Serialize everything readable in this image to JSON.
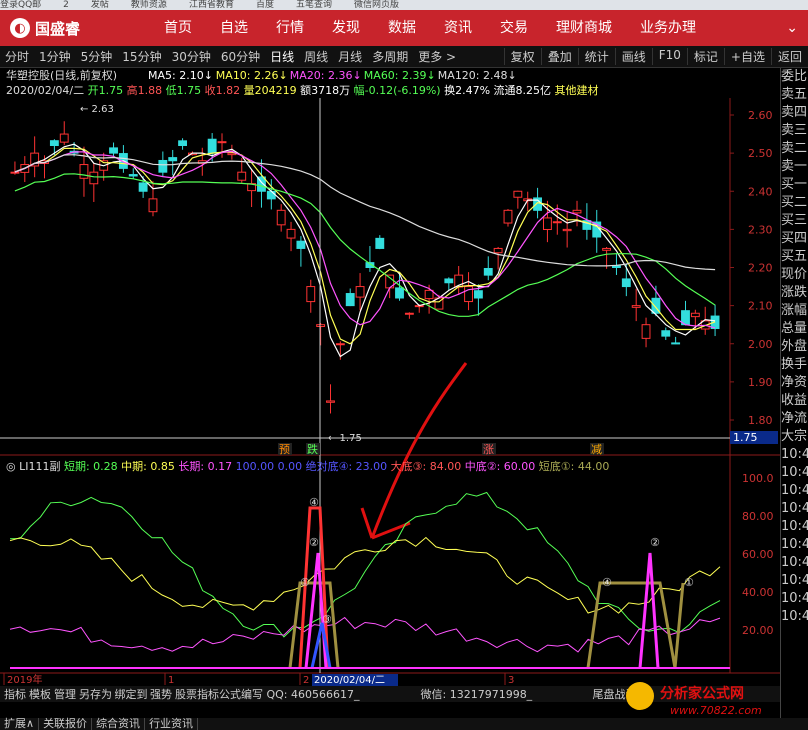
{
  "browser_tabs": [
    "登录QQ邮",
    "2",
    "发帖",
    "教师资源",
    "江西省教育",
    "百度",
    "五笔查询",
    "微信网页版"
  ],
  "app": {
    "logo_text": "国盛睿",
    "nav": [
      "首页",
      "自选",
      "行情",
      "发现",
      "数据",
      "资讯",
      "交易",
      "理财商城",
      "业务办理"
    ],
    "caret": "⌄"
  },
  "periods": [
    "分时",
    "1分钟",
    "5分钟",
    "15分钟",
    "30分钟",
    "60分钟",
    "日线",
    "周线",
    "月线",
    "多周期",
    "更多 >"
  ],
  "active_period": "日线",
  "tools": [
    "复权",
    "叠加",
    "统计",
    "画线",
    "F10",
    "标记",
    "+自选",
    "返回"
  ],
  "stock": {
    "title": "华塑控股(日线,前复权)",
    "ma": [
      {
        "label": "MA5: 2.10",
        "color": "#ffffff"
      },
      {
        "label": "MA10: 2.26",
        "color": "#ffff55"
      },
      {
        "label": "MA20: 2.36",
        "color": "#ff55ff"
      },
      {
        "label": "MA60: 2.39",
        "color": "#55ff55"
      },
      {
        "label": "MA120: 2.48",
        "color": "#dddddd"
      }
    ],
    "quote_date": "2020/02/04/二",
    "quote_parts": [
      {
        "t": "开1.75",
        "c": "#55ff55"
      },
      {
        "t": "高1.88",
        "c": "#ff5555"
      },
      {
        "t": "低1.75",
        "c": "#55ff55"
      },
      {
        "t": "收1.82",
        "c": "#ff5555"
      },
      {
        "t": "量204219",
        "c": "#ffff55"
      },
      {
        "t": "额3718万",
        "c": "#ffffff"
      },
      {
        "t": "幅-0.12(-6.19%)",
        "c": "#55ff55"
      },
      {
        "t": "换2.47%",
        "c": "#ffffff"
      },
      {
        "t": "流通8.25亿",
        "c": "#ffffff"
      },
      {
        "t": "其他建材",
        "c": "#ffff55"
      }
    ],
    "max_label": "2.63",
    "min_label": "1.75",
    "cursor_price": "1.75",
    "y_ticks": [
      "2.60",
      "2.50",
      "2.40",
      "2.30",
      "2.20",
      "2.10",
      "2.00",
      "1.90",
      "1.80"
    ],
    "signals": [
      {
        "t": "预",
        "c": "#ff8800"
      },
      {
        "t": "跌",
        "c": "#55ff55"
      },
      {
        "t": "涨",
        "c": "#ff5555"
      },
      {
        "t": "减",
        "c": "#ffaa00"
      }
    ]
  },
  "indicator": {
    "name": "LI111副",
    "params": [
      {
        "t": "短期: 0.28",
        "c": "#55ff55"
      },
      {
        "t": "中期: 0.85",
        "c": "#ffff55"
      },
      {
        "t": "长期: 0.17",
        "c": "#ff55ff"
      },
      {
        "t": "100.00",
        "c": "#5555ff"
      },
      {
        "t": "0.00",
        "c": "#5555ff"
      },
      {
        "t": "绝对底④: 23.00",
        "c": "#5555ff"
      },
      {
        "t": "大底③: 84.00",
        "c": "#ff5555"
      },
      {
        "t": "中底②: 60.00",
        "c": "#ff55ff"
      },
      {
        "t": "短底①: 44.00",
        "c": "#aaaa55"
      }
    ],
    "y_ticks": [
      "100.0",
      "80.00",
      "60.00",
      "40.00",
      "20.00"
    ],
    "markers": [
      "④",
      "②",
      "③",
      "①",
      "④",
      "②",
      "①"
    ]
  },
  "time_axis": {
    "labels": [
      "2019年",
      "1",
      "2",
      "3"
    ],
    "cursor_date": "2020/02/04/二"
  },
  "bottom_bar": [
    "指标",
    "模板",
    "管理",
    "另存为",
    "绑定到",
    "强势",
    "股票指标公式编写 QQ: 460566617_",
    "微信: 13217971998_",
    "尾盘战法"
  ],
  "bottom_links": [
    "扩展∧",
    "关联报价",
    "综合资讯",
    "行业资讯"
  ],
  "right_panel": [
    "委比",
    "卖五",
    "卖四",
    "卖三",
    "卖二",
    "卖一",
    "买一",
    "买二",
    "买三",
    "买四",
    "买五",
    "现价",
    "涨跌",
    "涨幅",
    "总量",
    "外盘",
    "换手",
    "净资",
    "收益",
    "净流",
    "大宗"
  ],
  "right_time_ticks": [
    "10:4",
    "10:4",
    "10:4",
    "10:4",
    "10:4",
    "10:4",
    "10:4",
    "10:4",
    "10:4",
    "10:4"
  ],
  "watermark": {
    "cn": "分析家公式网",
    "url": "www.70822.com"
  }
}
